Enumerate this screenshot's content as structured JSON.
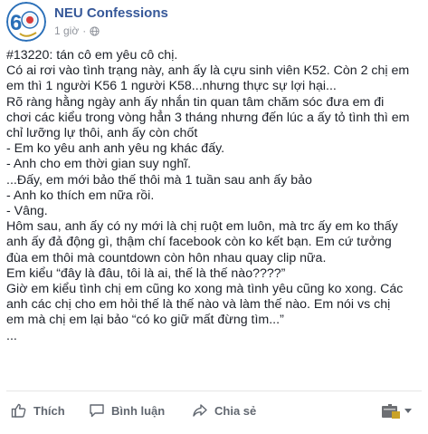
{
  "post": {
    "page_name": "NEU Confessions",
    "time": "1 giờ",
    "lines": [
      "#13220: tán cô em yêu cô chị.",
      "Có ai rơi vào tình trạng này, anh ấy là cựu sinh viên K52. Còn 2 chị em",
      "em thì 1 người K56 1 người K58...nhưng thực sự lợi hại...",
      "Rõ ràng hằng ngày anh ấy nhắn tin quan tâm chăm sóc đưa em đi",
      "chơi các kiểu trong vòng hẳn 3 tháng nhưng đến lúc a ấy tỏ tình thì em",
      "chỉ lưỡng lự thôi, anh ấy còn chốt",
      "- Em ko yêu anh anh yêu ng khác đấy.",
      "- Anh cho em thời gian suy nghĩ.",
      "...Đấy, em mới bảo thế thôi mà 1 tuần sau anh ấy bảo",
      "- Anh ko thích em nữa rồi.",
      "- Vâng.",
      "Hôm sau, anh ấy có ny mới là chị ruột em luôn, mà trc ấy em ko thấy",
      "anh ấy đả động gì, thậm chí facebook còn ko kết bạn. Em cứ tưởng",
      "đùa em thôi mà countdown còn hôn nhau quay clip nữa.",
      "Em kiểu “đây là đâu, tôi là ai, thế là thế nào????”",
      "Giờ em kiểu tình chị em cũng ko xong mà tình yêu cũng ko xong. Các",
      "anh các chị cho em hỏi thế là thế nào và làm thế nào. Em nói vs chị",
      "em mà chị em lại bảo “có ko giữ mất đừng tìm...”",
      "..."
    ]
  },
  "actions": {
    "like": "Thích",
    "comment": "Bình luận",
    "share": "Chia sẻ"
  },
  "colors": {
    "page_name": "#365899",
    "meta": "#90949c",
    "action": "#616770"
  }
}
